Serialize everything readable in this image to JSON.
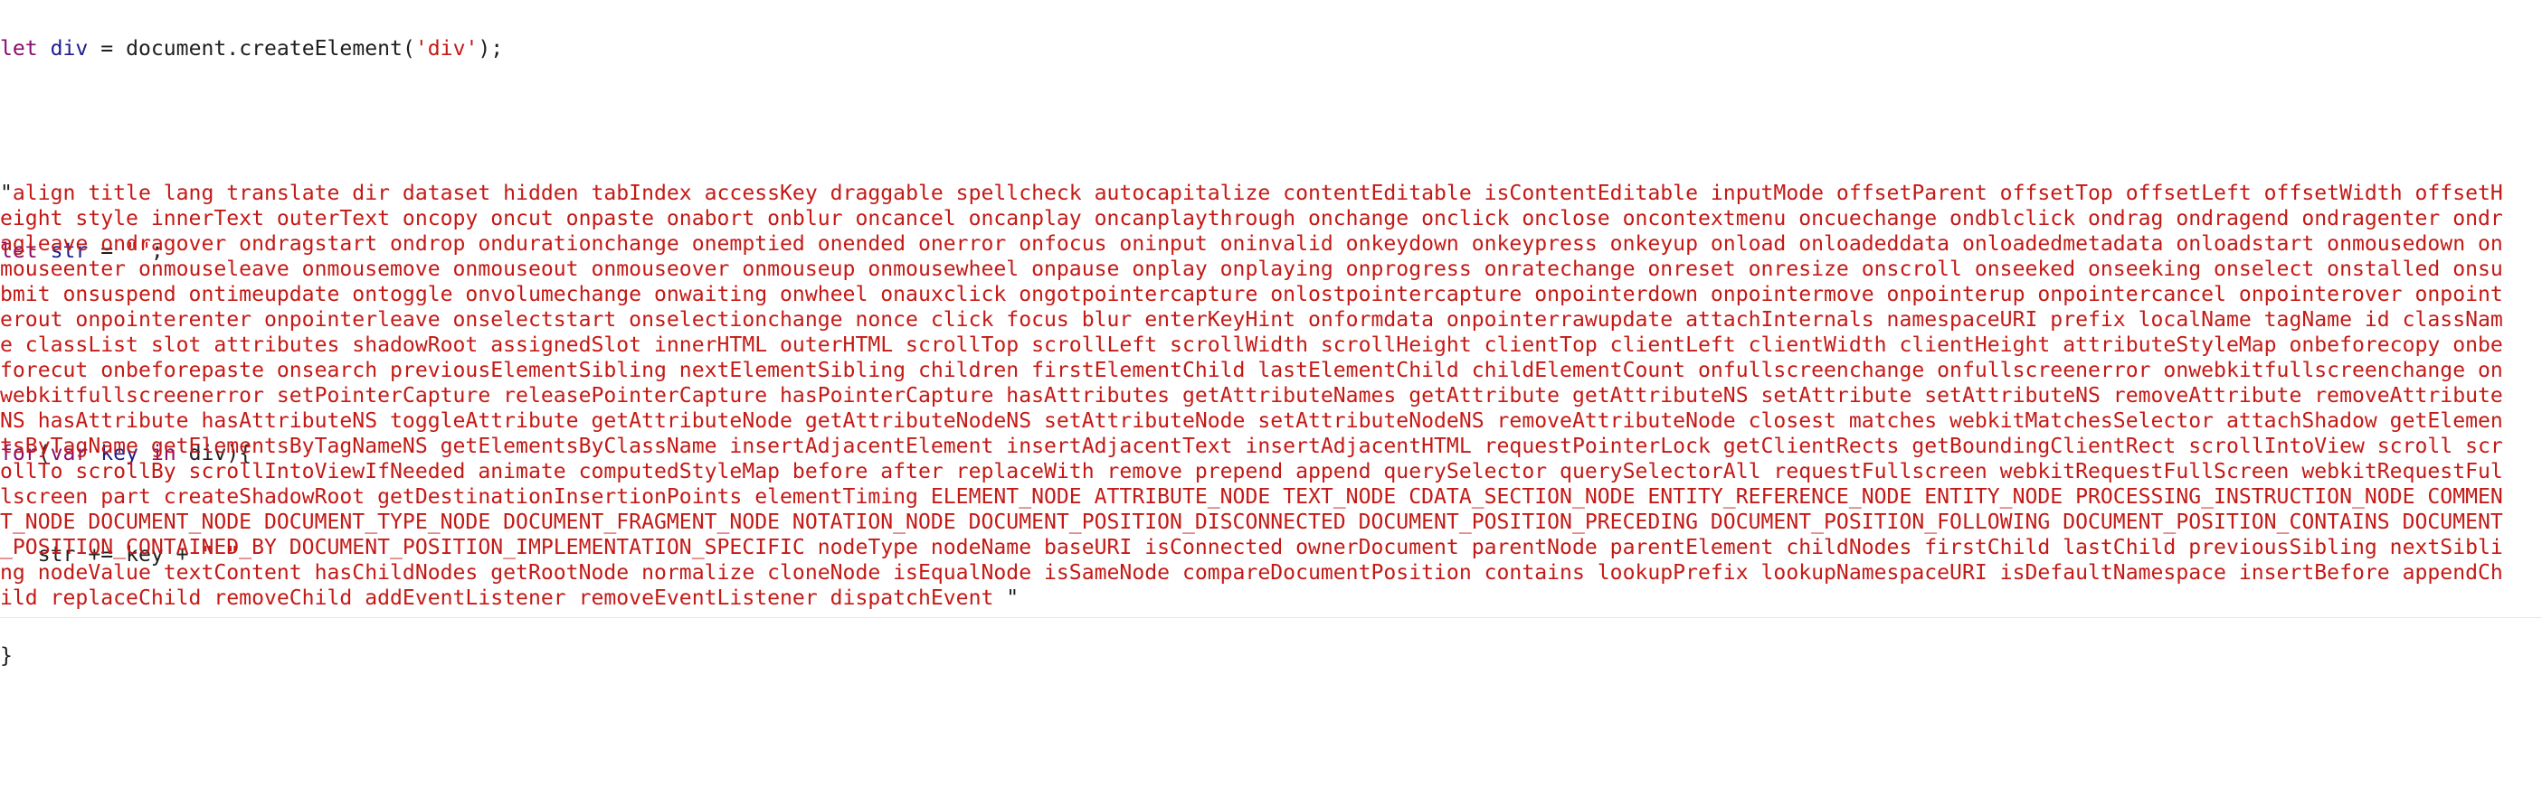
{
  "console": {
    "code": {
      "line1": {
        "kw": "let",
        "name": " div",
        "eq": " = ",
        "call": "document.createElement(",
        "arg": "'div'",
        "end": ");"
      },
      "line2": {
        "kw": "let",
        "name": " str",
        "eq": " = ",
        "arg": "\"\"",
        "end": ";"
      },
      "line3": {
        "kw": "for",
        "open": "(",
        "kw2": "var",
        "sp": " ",
        "key": "key",
        "in": " in ",
        "obj": "div",
        "close": "){"
      },
      "line4": {
        "indent": "   ",
        "lhs": "str",
        "op": " += ",
        "rhs": "key",
        "plus": " + ",
        "arg": "\" \""
      },
      "line5": {
        "close": "}"
      }
    },
    "result": {
      "open_quote": "\"",
      "value": "align title lang translate dir dataset hidden tabIndex accessKey draggable spellcheck autocapitalize contentEditable isContentEditable inputMode offsetParent offsetTop offsetLeft offsetWidth offsetHeight style innerText outerText oncopy oncut onpaste onabort onblur oncancel oncanplay oncanplaythrough onchange onclick onclose oncontextmenu oncuechange ondblclick ondrag ondragend ondragenter ondragleave ondragover ondragstart ondrop ondurationchange onemptied onended onerror onfocus oninput oninvalid onkeydown onkeypress onkeyup onload onloadeddata onloadedmetadata onloadstart onmousedown onmouseenter onmouseleave onmousemove onmouseout onmouseover onmouseup onmousewheel onpause onplay onplaying onprogress onratechange onreset onresize onscroll onseeked onseeking onselect onstalled onsubmit onsuspend ontimeupdate ontoggle onvolumechange onwaiting onwheel onauxclick ongotpointercapture onlostpointercapture onpointerdown onpointermove onpointerup onpointercancel onpointerover onpointerout onpointerenter onpointerleave onselectstart onselectionchange nonce click focus blur enterKeyHint onformdata onpointerrawupdate attachInternals namespaceURI prefix localName tagName id className classList slot attributes shadowRoot assignedSlot innerHTML outerHTML scrollTop scrollLeft scrollWidth scrollHeight clientTop clientLeft clientWidth clientHeight attributeStyleMap onbeforecopy onbeforecut onbeforepaste onsearch previousElementSibling nextElementSibling children firstElementChild lastElementChild childElementCount onfullscreenchange onfullscreenerror onwebkitfullscreenchange onwebkitfullscreenerror setPointerCapture releasePointerCapture hasPointerCapture hasAttributes getAttributeNames getAttribute getAttributeNS setAttribute setAttributeNS removeAttribute removeAttributeNS hasAttribute hasAttributeNS toggleAttribute getAttributeNode getAttributeNodeNS setAttributeNode setAttributeNodeNS removeAttributeNode closest matches webkitMatchesSelector attachShadow getElementsByTagName getElementsByTagNameNS getElementsByClassName insertAdjacentElement insertAdjacentText insertAdjacentHTML requestPointerLock getClientRects getBoundingClientRect scrollIntoView scroll scrollTo scrollBy scrollIntoViewIfNeeded animate computedStyleMap before after replaceWith remove prepend append querySelector querySelectorAll requestFullscreen webkitRequestFullScreen webkitRequestFullscreen part createShadowRoot getDestinationInsertionPoints elementTiming ELEMENT_NODE ATTRIBUTE_NODE TEXT_NODE CDATA_SECTION_NODE ENTITY_REFERENCE_NODE ENTITY_NODE PROCESSING_INSTRUCTION_NODE COMMENT_NODE DOCUMENT_NODE DOCUMENT_TYPE_NODE DOCUMENT_FRAGMENT_NODE NOTATION_NODE DOCUMENT_POSITION_DISCONNECTED DOCUMENT_POSITION_PRECEDING DOCUMENT_POSITION_FOLLOWING DOCUMENT_POSITION_CONTAINS DOCUMENT_POSITION_CONTAINED_BY DOCUMENT_POSITION_IMPLEMENTATION_SPECIFIC nodeType nodeName baseURI isConnected ownerDocument parentNode parentElement childNodes firstChild lastChild previousSibling nextSibling nodeValue textContent hasChildNodes getRootNode normalize cloneNode isEqualNode isSameNode compareDocumentPosition contains lookupPrefix lookupNamespaceURI isDefaultNamespace insertBefore appendChild replaceChild removeChild addEventListener removeEventListener dispatchEvent ",
      "close_quote": "\""
    }
  }
}
